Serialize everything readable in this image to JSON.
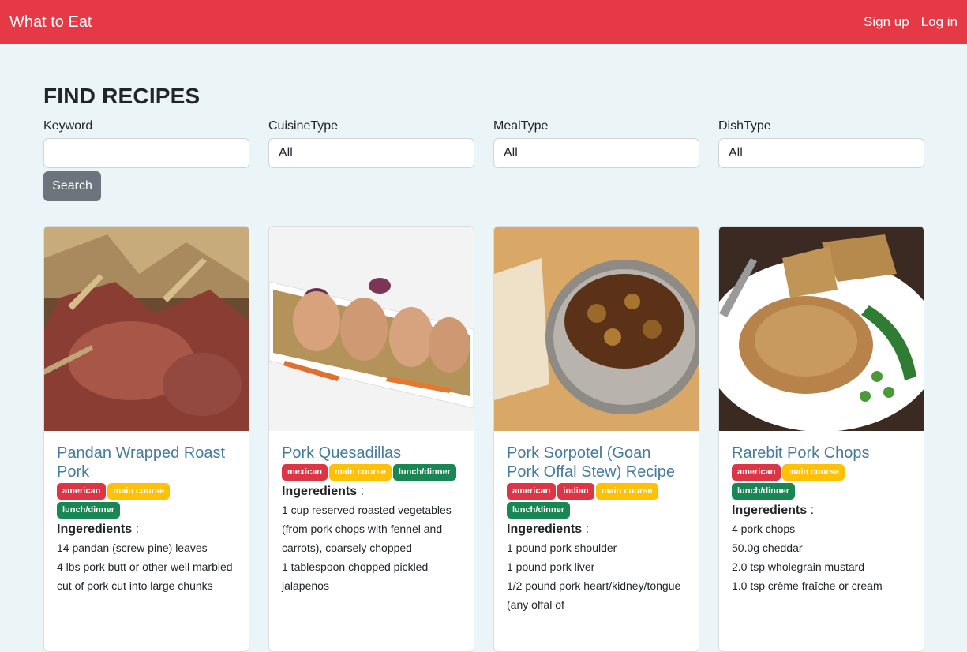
{
  "nav": {
    "brand": "What to Eat",
    "signup": "Sign up",
    "login": "Log in"
  },
  "page": {
    "title": "FIND RECIPES"
  },
  "filters": {
    "keyword": {
      "label": "Keyword",
      "value": ""
    },
    "cuisine": {
      "label": "CuisineType",
      "value": "All"
    },
    "meal": {
      "label": "MealType",
      "value": "All"
    },
    "dish": {
      "label": "DishType",
      "value": "All"
    },
    "search_label": "Search"
  },
  "ingredients_heading": "Ingeredients",
  "ingredients_colon": " :",
  "recipes": [
    {
      "title": "Pandan Wrapped Roast Pork",
      "tags": [
        "american",
        "main course",
        "lunch/dinner"
      ],
      "ingredients": [
        "14 pandan (screw pine) leaves",
        "4 lbs pork butt or other well marbled cut of pork cut into large chunks"
      ]
    },
    {
      "title": "Pork Quesadillas",
      "tags": [
        "mexican",
        "main course",
        "lunch/dinner"
      ],
      "ingredients": [
        "1 cup reserved roasted vegetables (from pork chops with fennel and carrots), coarsely chopped",
        "1 tablespoon chopped pickled jalapenos"
      ]
    },
    {
      "title": "Pork Sorpotel (Goan Pork Offal Stew) Recipe",
      "tags": [
        "american",
        "indian",
        "main course",
        "lunch/dinner"
      ],
      "ingredients": [
        "1 pound pork shoulder",
        "1 pound pork liver",
        "1/2 pound pork heart/kidney/tongue (any offal of"
      ]
    },
    {
      "title": "Rarebit Pork Chops",
      "tags": [
        "american",
        "main course",
        "lunch/dinner"
      ],
      "ingredients": [
        "4 pork chops",
        "50.0g cheddar",
        "2.0 tsp wholegrain mustard",
        "1.0 tsp crème fraîche or cream"
      ]
    }
  ],
  "colors": {
    "navbar": "#e63946",
    "title_link": "#457b9d",
    "cuisine_tag": "#dc3545",
    "dish_tag": "#ffc107",
    "meal_tag": "#198754"
  }
}
